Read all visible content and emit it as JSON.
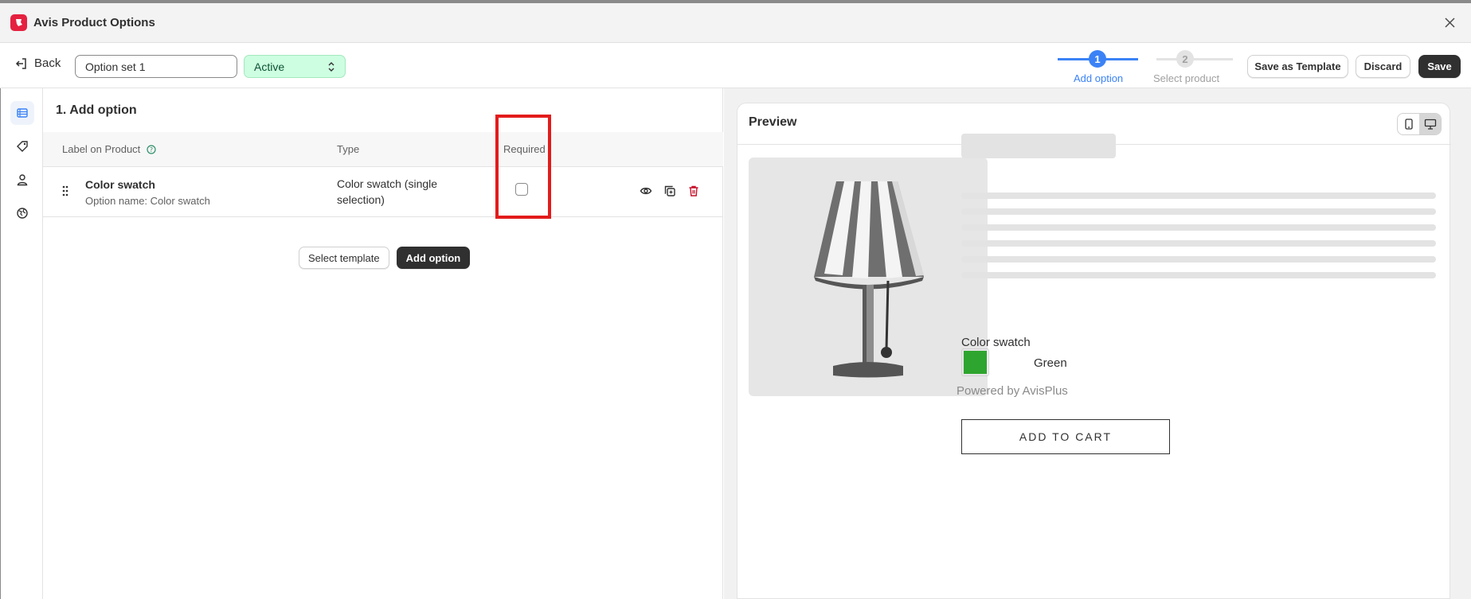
{
  "app": {
    "title": "Avis Product Options"
  },
  "toolbar": {
    "back_label": "Back",
    "option_set_name": "Option set 1",
    "status_value": "Active",
    "steps": [
      {
        "number": "1",
        "label": "Add option",
        "state": "active"
      },
      {
        "number": "2",
        "label": "Select product",
        "state": "inactive"
      }
    ],
    "save_template_label": "Save as Template",
    "discard_label": "Discard",
    "save_label": "Save"
  },
  "rail": {
    "items": [
      {
        "icon": "options-list-icon",
        "active": true
      },
      {
        "icon": "tag-icon",
        "active": false
      },
      {
        "icon": "person-icon",
        "active": false
      },
      {
        "icon": "globe-icon",
        "active": false
      }
    ]
  },
  "options": {
    "section_title": "1. Add option",
    "columns": {
      "label": "Label on Product",
      "type": "Type",
      "required": "Required"
    },
    "rows": [
      {
        "label": "Color swatch",
        "option_name": "Option name: Color swatch",
        "type": "Color swatch (single selection)",
        "required": false
      }
    ],
    "select_template_label": "Select template",
    "add_option_label": "Add option"
  },
  "preview": {
    "title": "Preview",
    "swatch_label": "Color swatch",
    "swatch_value": "Green",
    "swatch_color": "#2ea52e",
    "powered_by": "Powered by AvisPlus",
    "add_to_cart": "ADD TO CART"
  },
  "colors": {
    "accent": "#3b82f6",
    "status_bg": "#cdfee1",
    "highlight": "#e31b1b",
    "danger": "#c5102a"
  }
}
